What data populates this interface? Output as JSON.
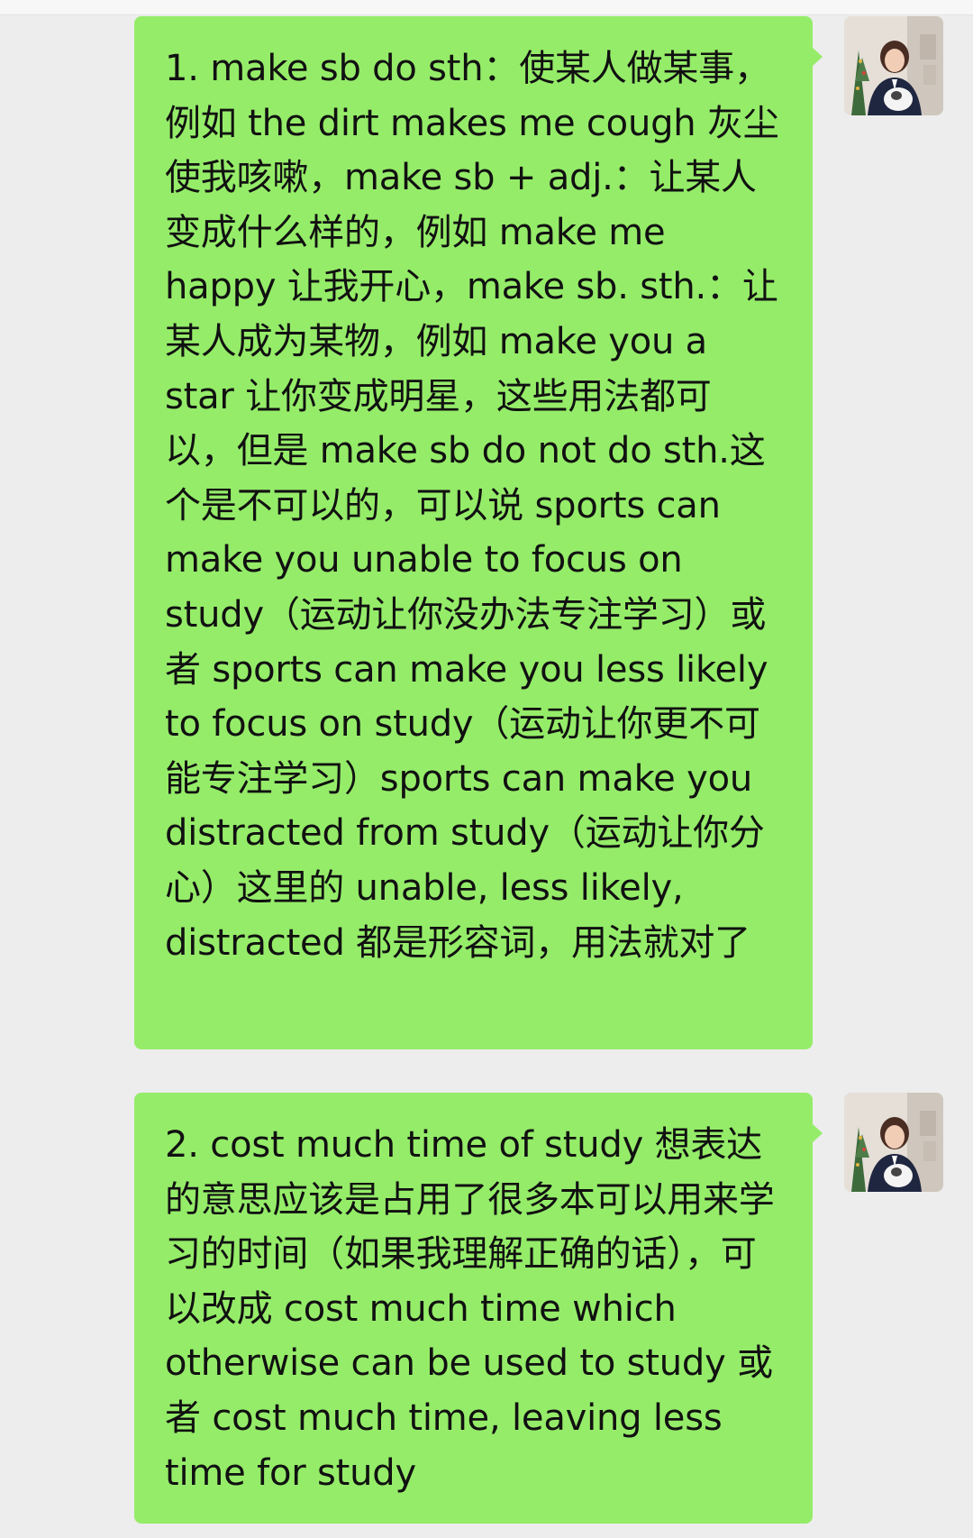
{
  "messages": [
    {
      "sender": "self",
      "text": "1. make sb do sth：使某人做某事，例如 the dirt makes me cough 灰尘使我咳嗽，make sb + adj.：让某人变成什么样的，例如 make me happy 让我开心，make sb. sth.：让某人成为某物，例如 make you a star 让你变成明星，这些用法都可以，但是 make sb do not do sth.这个是不可以的，可以说 sports can make you unable to focus on study（运动让你没办法专注学习）或者 sports can make you less likely to focus on study（运动让你更不可能专注学习）sports can make you distracted from study（运动让你分心）这里的 unable, less likely, distracted 都是形容词，用法就对了"
    },
    {
      "sender": "self",
      "text": "2. cost much time of study 想表达的意思应该是占用了很多本可以用来学习的时间（如果我理解正确的话），可以改成 cost much time which otherwise can be used to study 或者 cost much time, leaving less time for study"
    }
  ],
  "colors": {
    "background": "#ededed",
    "bubble": "#95ec69",
    "text": "#111111"
  }
}
